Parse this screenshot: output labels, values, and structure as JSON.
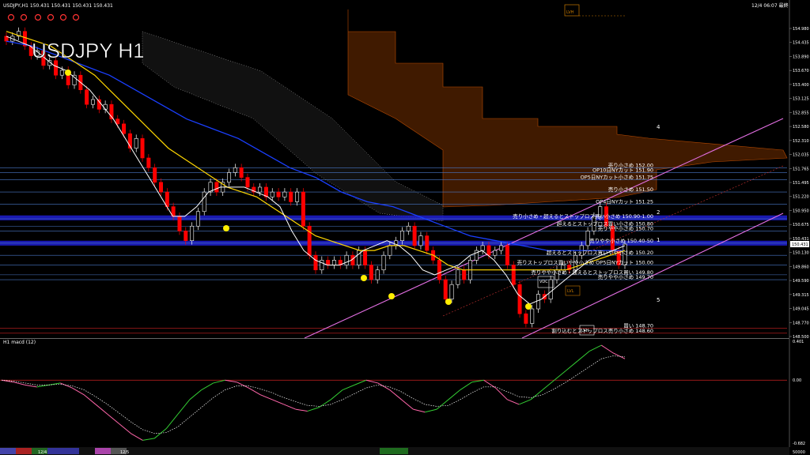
{
  "header": {
    "symbol_info": "USDJPY,H1  150.431 150.431 150.431 150.431",
    "datetime": "12/4 06:07 最終",
    "title": "USDJPY H1"
  },
  "indicator": {
    "label": "H1  macd (12)"
  },
  "colors": {
    "background": "#000000",
    "bull_candle": "#ffffff",
    "bear_candle": "#ff0000",
    "ma_fast": "#ffffff",
    "ma_mid": "#ffd700",
    "ma_slow": "#1a3fff",
    "hline": "#4a78c8",
    "zone": "#1f1fd0",
    "channel": "#e36fe3",
    "cloud": "#b84a00",
    "macd": "#33cc33",
    "macd_neg": "#ff66aa",
    "signal": "#ffffff"
  },
  "chart_data": [
    {
      "type": "candlestick",
      "y_axis_ticks": [
        "154.980",
        "154.435",
        "153.890",
        "153.670",
        "153.400",
        "153.125",
        "152.855",
        "152.580",
        "152.310",
        "152.035",
        "151.765",
        "151.495",
        "151.220",
        "150.950",
        "150.675",
        "150.431",
        "150.130",
        "149.860",
        "149.590",
        "149.315",
        "149.045",
        "148.770",
        "148.500"
      ],
      "ylim": [
        148.5,
        155.25
      ],
      "price_levels": [
        {
          "label": "売り小さめ 152.00",
          "value": 152.0
        },
        {
          "label": "OP10日NYカット 151.90",
          "value": 151.9
        },
        {
          "label": "OP5日NYカット小さめ 151.75",
          "value": 151.75
        },
        {
          "label": "売り小さめ 151.50",
          "value": 151.5
        },
        {
          "label": "OP4日NYカット 151.25",
          "value": 151.25
        },
        {
          "label": "売り小さめ・超えるとストップロス買い小さめ 150.90-1.00",
          "value": 150.95
        },
        {
          "label": "超えるとストップロス買い小さめ 150.80",
          "value": 150.8
        },
        {
          "label": "売りやや小さめ 150.70",
          "value": 150.7
        },
        {
          "label": "売りやや小さめ 150.40-50",
          "value": 150.45
        },
        {
          "label": "超えるとストップロス買いやや小さめ 150.20",
          "value": 150.2
        },
        {
          "label": "売りストップロス買いやや小さめ OP5日NYカット 150.00",
          "value": 150.0
        },
        {
          "label": "売りやや小さめ・超えるとストップロス買い 149.80",
          "value": 149.8
        },
        {
          "label": "売りやや小さめ 149.70",
          "value": 149.7
        },
        {
          "label": "買い 148.70",
          "value": 148.7
        },
        {
          "label": "割り込むとストップロス売り小さめ 148.60",
          "value": 148.6
        }
      ],
      "current_price": "150.431",
      "wave_labels": [
        "4",
        "2",
        "1",
        "5"
      ],
      "box_labels": [
        "LVH",
        "VDC",
        "LVL",
        "LVH"
      ],
      "closes": [
        154.6,
        154.7,
        154.8,
        154.5,
        154.3,
        154.4,
        154.1,
        154.2,
        153.9,
        154.0,
        153.7,
        153.9,
        153.6,
        153.3,
        153.4,
        153.2,
        153.3,
        153.0,
        152.9,
        152.7,
        152.4,
        152.6,
        152.2,
        152.0,
        151.7,
        151.5,
        151.2,
        151.0,
        150.7,
        150.5,
        150.8,
        151.1,
        151.5,
        151.7,
        151.5,
        151.7,
        151.9,
        152.0,
        151.8,
        151.6,
        151.5,
        151.6,
        151.4,
        151.5,
        151.4,
        151.5,
        151.3,
        151.5,
        150.8,
        150.2,
        149.9,
        150.1,
        150.0,
        150.1,
        150.0,
        150.2,
        150.0,
        150.3,
        150.0,
        149.7,
        149.9,
        150.2,
        150.4,
        150.5,
        150.7,
        150.8,
        150.4,
        150.6,
        150.3,
        150.1,
        149.7,
        149.3,
        149.6,
        149.9,
        149.7,
        150.1,
        150.3,
        150.4,
        150.2,
        150.3,
        150.4,
        150.0,
        149.6,
        149.0,
        148.8,
        149.1,
        149.4,
        149.3,
        149.7,
        149.9,
        150.0,
        149.9,
        150.2,
        150.4,
        150.7,
        151.0,
        151.2,
        150.8,
        150.3,
        150.0,
        150.43
      ],
      "ma_fast": [
        154.7,
        154.6,
        154.5,
        154.3,
        154.1,
        154.0,
        153.8,
        153.6,
        153.3,
        153.0,
        152.6,
        152.2,
        151.8,
        151.4,
        151.0,
        151.0,
        151.2,
        151.5,
        151.6,
        151.6,
        151.6,
        151.5,
        151.4,
        151.2,
        150.7,
        150.3,
        150.1,
        150.0,
        150.0,
        150.1,
        150.3,
        150.4,
        150.5,
        150.4,
        150.2,
        149.9,
        149.8,
        149.9,
        150.0,
        150.2,
        150.3,
        150.1,
        149.8,
        149.4,
        149.2,
        149.3,
        149.5,
        149.7,
        149.9,
        150.1,
        150.2,
        150.3,
        150.4
      ],
      "ma_mid": [
        154.8,
        154.7,
        154.6,
        154.5,
        154.3,
        154.1,
        153.9,
        153.6,
        153.3,
        153.0,
        152.7,
        152.4,
        152.2,
        152.0,
        151.8,
        151.6,
        151.5,
        151.4,
        151.2,
        151.0,
        150.8,
        150.6,
        150.5,
        150.4,
        150.3,
        150.3,
        150.4,
        150.4,
        150.3,
        150.2,
        150.0,
        149.9,
        149.9,
        149.9,
        149.9,
        149.9,
        149.9,
        149.9,
        149.9,
        150.0,
        150.1,
        150.2,
        150.3
      ],
      "ma_slow": [
        154.6,
        154.5,
        154.3,
        154.1,
        153.9,
        153.6,
        153.3,
        153.0,
        152.8,
        152.6,
        152.3,
        152.0,
        151.8,
        151.5,
        151.3,
        151.2,
        151.0,
        150.8,
        150.6,
        150.5,
        150.4,
        150.3,
        150.3,
        150.3,
        150.3
      ]
    },
    {
      "type": "line",
      "name": "macd (12)",
      "y_axis_ticks": [
        "0.401",
        "0.00",
        "-0.682"
      ],
      "ylim": [
        -0.682,
        0.401
      ],
      "macd": [
        0.0,
        -0.02,
        -0.05,
        -0.07,
        -0.05,
        -0.03,
        -0.08,
        -0.15,
        -0.25,
        -0.35,
        -0.45,
        -0.55,
        -0.62,
        -0.6,
        -0.5,
        -0.35,
        -0.2,
        -0.1,
        -0.03,
        0.0,
        -0.02,
        -0.08,
        -0.15,
        -0.2,
        -0.25,
        -0.3,
        -0.32,
        -0.28,
        -0.2,
        -0.1,
        -0.05,
        0.0,
        -0.03,
        -0.1,
        -0.2,
        -0.3,
        -0.33,
        -0.3,
        -0.2,
        -0.1,
        -0.02,
        0.0,
        -0.08,
        -0.2,
        -0.25,
        -0.2,
        -0.1,
        0.0,
        0.1,
        0.2,
        0.3,
        0.36,
        0.28,
        0.22
      ],
      "signal": [
        0.0,
        -0.01,
        -0.03,
        -0.05,
        -0.05,
        -0.04,
        -0.06,
        -0.1,
        -0.17,
        -0.25,
        -0.34,
        -0.43,
        -0.51,
        -0.55,
        -0.54,
        -0.48,
        -0.38,
        -0.28,
        -0.18,
        -0.1,
        -0.06,
        -0.06,
        -0.09,
        -0.13,
        -0.18,
        -0.22,
        -0.26,
        -0.27,
        -0.25,
        -0.2,
        -0.14,
        -0.08,
        -0.05,
        -0.07,
        -0.12,
        -0.19,
        -0.25,
        -0.27,
        -0.26,
        -0.2,
        -0.13,
        -0.07,
        -0.07,
        -0.12,
        -0.17,
        -0.18,
        -0.15,
        -0.09,
        -0.02,
        0.06,
        0.14,
        0.22,
        0.25,
        0.24
      ]
    }
  ],
  "date_tags": [
    "12/4",
    "12/5"
  ],
  "footer_tag": "50000"
}
